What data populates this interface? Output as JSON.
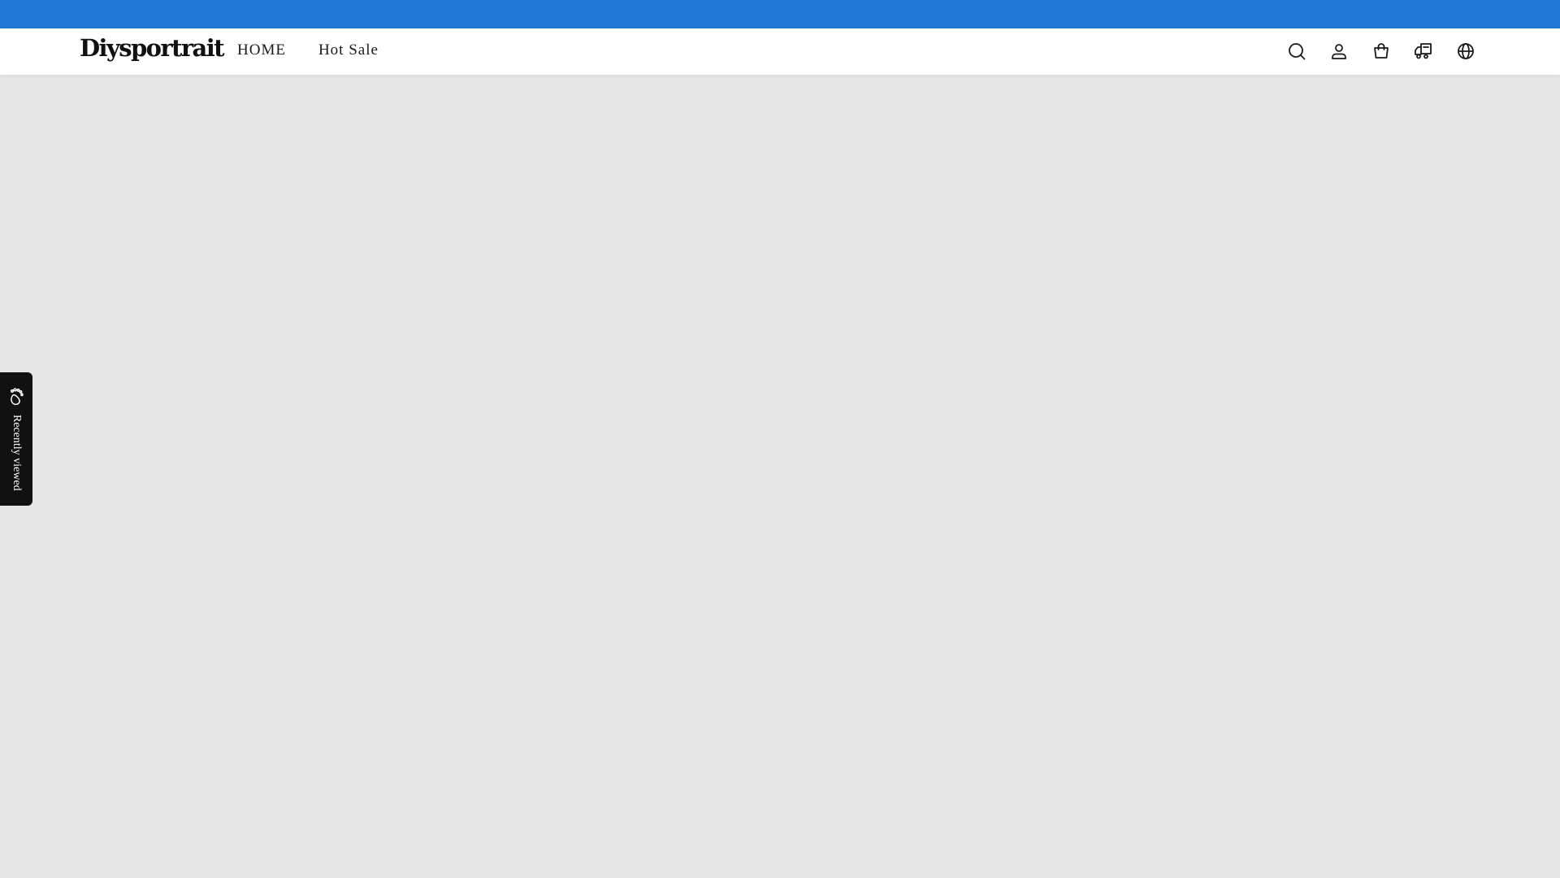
{
  "colors": {
    "announcement_bar": "#2178d6",
    "header_bg": "#ffffff",
    "page_bg": "#e5e5e5",
    "sidebar_tab_bg": "#111111"
  },
  "header": {
    "logo": "Diysportrait",
    "nav": [
      {
        "label": "HOME"
      },
      {
        "label": "Hot Sale"
      }
    ],
    "icons": [
      "search-icon",
      "account-icon",
      "cart-icon",
      "order-tracking-icon",
      "language-icon"
    ]
  },
  "recently_viewed": {
    "label": "Recently viewed",
    "icon": "footprint-icon"
  }
}
